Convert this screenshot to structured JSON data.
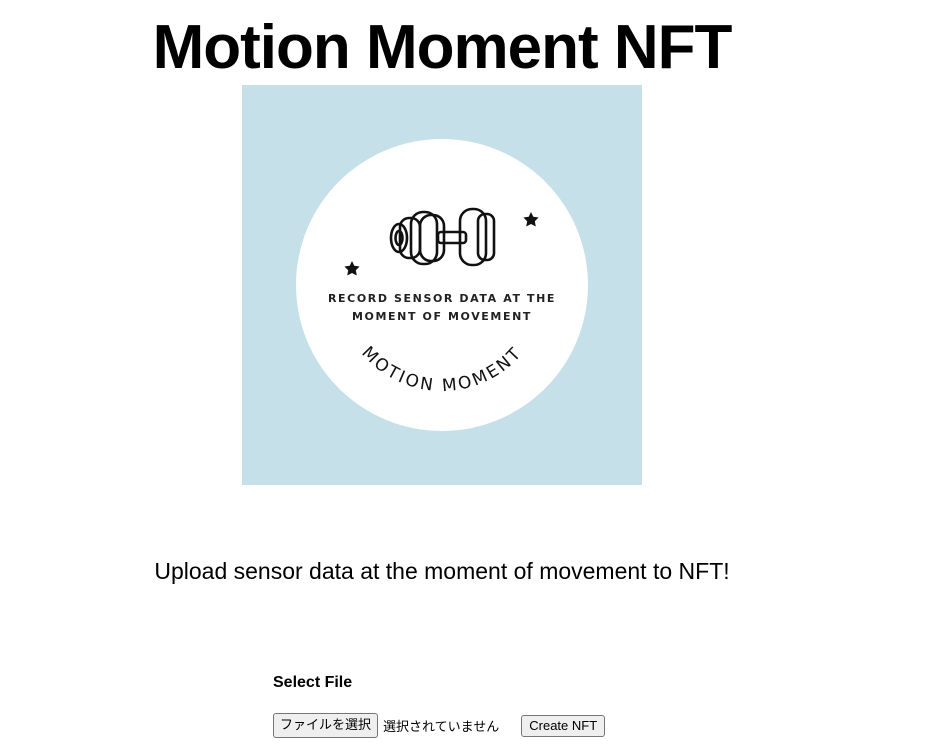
{
  "header": {
    "title": "Motion Moment NFT"
  },
  "logo": {
    "background_color": "#c5e0e8",
    "line1": "RECORD SENSOR DATA AT THE",
    "line2": "MOMENT OF MOVEMENT",
    "arc_text": "MOTION MOMENT",
    "icons": [
      "dumbbell-icon",
      "star-icon",
      "star-icon"
    ]
  },
  "tagline": "Upload sensor data at the moment of movement to NFT!",
  "form": {
    "select_label": "Select File",
    "file_button_label": "ファイルを選択",
    "no_file_text": "選択されていません",
    "create_button_label": "Create NFT"
  }
}
